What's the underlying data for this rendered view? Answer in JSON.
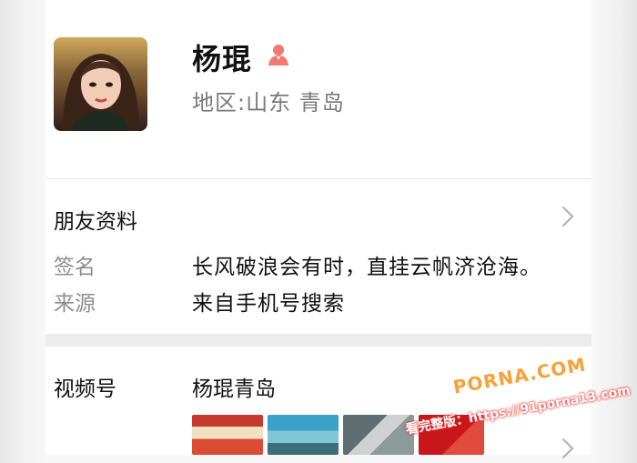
{
  "profile": {
    "name": "杨琨",
    "region": "地区:山东 青岛",
    "gender_icon": "person-icon",
    "gender_color": "#f17b6f"
  },
  "friend_info": {
    "title": "朋友资料",
    "rows": [
      {
        "label": "签名",
        "value": "长风破浪会有时，直挂云帆济沧海。"
      },
      {
        "label": "来源",
        "value": "来自手机号搜索"
      }
    ]
  },
  "channel": {
    "label": "视频号",
    "name": "杨琨青岛",
    "thumbnails": [
      "video-thumbnail-1",
      "video-thumbnail-2",
      "video-thumbnail-3",
      "video-thumbnail-4"
    ]
  },
  "watermark": {
    "brand": "PORNA.COM",
    "url": "看完整版：https://91porna13.com"
  }
}
